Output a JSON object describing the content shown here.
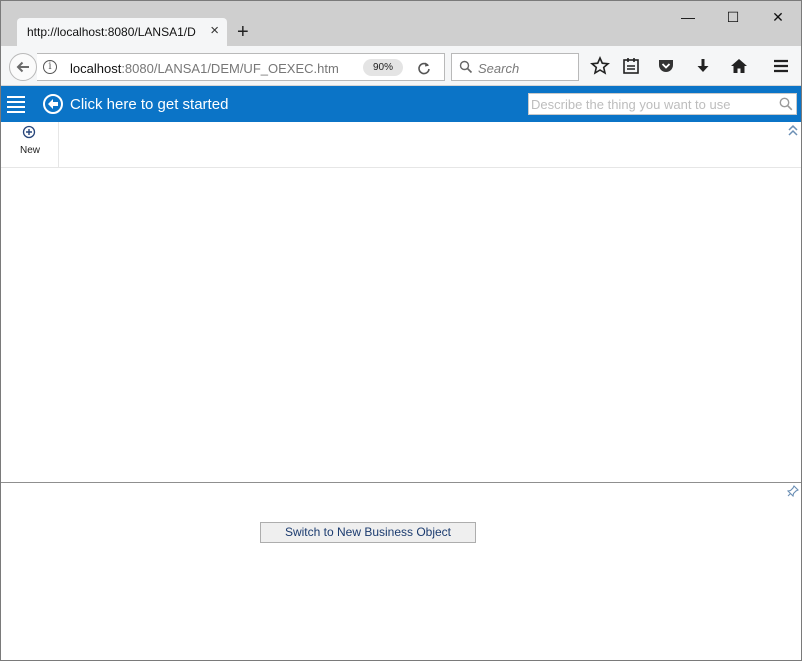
{
  "browser": {
    "tab_title": "http://localhost:8080/LANSA1/D",
    "tab_close": "×",
    "new_tab": "+",
    "window_controls": {
      "minimize": "—",
      "maximize": "☐",
      "close": "✕"
    },
    "url_host": "localhost",
    "url_rest": ":8080/LANSA1/DEM/UF_OEXEC.htm",
    "zoom": "90%",
    "search_placeholder": "Search",
    "toolbar_icons": [
      "bookmark-star-icon",
      "reading-list-icon",
      "pocket-icon",
      "download-icon",
      "home-icon",
      "hamburger-menu-icon"
    ]
  },
  "app": {
    "header_text": "Click here to get started",
    "describe_placeholder": "Describe the thing you want to use",
    "accent_color": "#0b74c7",
    "commands": [
      {
        "label": "New",
        "icon": "plus-circle-icon"
      }
    ],
    "switch_button_label": "Switch to New Business Object"
  }
}
